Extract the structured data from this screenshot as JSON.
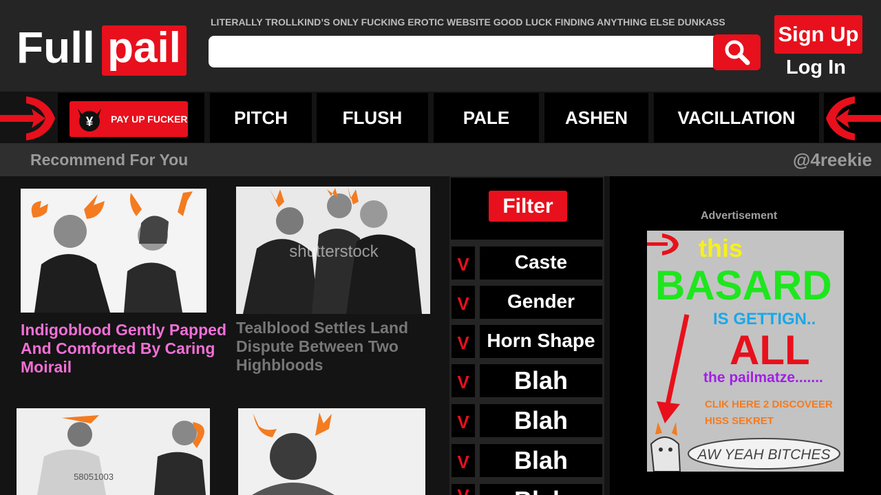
{
  "header": {
    "logo_left": "Full",
    "logo_right": "pail",
    "tagline": "LITERALLY TROLLKIND’S ONLY FUCKING EROTIC WEBSITE GOOD LUCK FINDING ANYTHING ELSE DUNKASS",
    "search_value": "",
    "signup_label": "Sign Up",
    "login_label": "Log In"
  },
  "nav": {
    "payup_label": "PAY UP FUCKER",
    "items": [
      "PITCH",
      "FLUSH",
      "PALE",
      "ASHEN",
      "VACILLATION"
    ]
  },
  "recommend": {
    "title": "Recommend For You",
    "user": "@4reekie"
  },
  "cards": [
    {
      "title": "Indigoblood Gently Papped And Comforted By Caring Moirail",
      "color": "#f26fd6",
      "watermark": ""
    },
    {
      "title": "Tealblood Settles Land Dispute Between Two Highbloods",
      "color": "#777777",
      "watermark": "shutterstock"
    },
    {
      "title": "",
      "color": "#777777",
      "watermark": "58051003"
    },
    {
      "title": "",
      "color": "#777777",
      "watermark": ""
    }
  ],
  "filter": {
    "label": "Filter",
    "items": [
      {
        "mark": "V",
        "label": "Caste"
      },
      {
        "mark": "V",
        "label": "Gender"
      },
      {
        "mark": "V",
        "label": "Horn Shape"
      },
      {
        "mark": "V",
        "label": "Blah"
      },
      {
        "mark": "V",
        "label": "Blah"
      },
      {
        "mark": "V",
        "label": "Blah"
      },
      {
        "mark": "V",
        "label": "Blah"
      }
    ]
  },
  "ad": {
    "label": "Advertisement",
    "line1": "this",
    "line2": "BASARD",
    "line3": "IS GETTIGN..",
    "line4": "ALL",
    "line5": "the pailmatze.......",
    "line6": "CLIK HERE 2 DISCOVEER",
    "line7": "HISS SEKRET",
    "bubble": "AW YEAH BITCHES"
  },
  "colors": {
    "brand_red": "#e8101c",
    "header_bg": "#252525",
    "card_title_pink": "#f26fd6",
    "card_title_grey": "#777777"
  }
}
